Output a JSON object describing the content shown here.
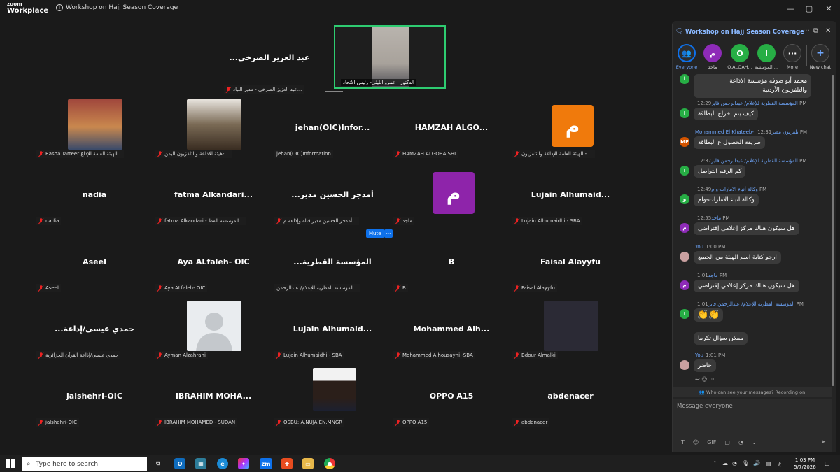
{
  "window": {
    "brand_top": "zoom",
    "brand_bottom": "Workplace",
    "meeting_title": "Workshop on Hajj Season Coverage",
    "controls": [
      "—",
      "▢",
      "✕"
    ]
  },
  "speaker": {
    "name": "عبد العزيز الصرخي...",
    "name_label": "عبد العزيز الصرخي - مدير النباد...",
    "video_label": "الدكتور : عمرو الليثي- رئيس الاتحاد"
  },
  "tiles": [
    {
      "name": "",
      "label": "Rasha Tarteer الهيئة العامة للإذاع..."
    },
    {
      "name": "",
      "label": "هيئة الاذاعة والتلفزيون اليمن- ..."
    },
    {
      "name": "jehan(OIC)Infor...",
      "label": "jehan(OIC)Information"
    },
    {
      "name": "HAMZAH  ALGO...",
      "label": "HAMZAH ALGOBAISHI"
    },
    {
      "name": "",
      "label": "الهيئة العامة للإذاعة والتلفزيون - ...",
      "avatar": "م"
    },
    {
      "name": "nadia",
      "label": "nadia"
    },
    {
      "name": "fatma  Alkandari...",
      "label": "fatma Alkandari - المؤسسة القط..."
    },
    {
      "name": "أمدجر الحسين مدير...",
      "label": "أمدجر الحسين مدير قناة وإذاعة م..."
    },
    {
      "name": "",
      "label": "ماجد",
      "avatar": "م"
    },
    {
      "name": "Lujain  Alhumaid...",
      "label": "Lujain Alhumaidhi - SBA"
    },
    {
      "name": "Aseel",
      "label": "Aseel"
    },
    {
      "name": "Aya ALfaleh- OIC",
      "label": "Aya ALfaleh- OIC"
    },
    {
      "name": "المؤسسة القطرية...",
      "label": "المؤسسة القطرية للإعلام/ عبدالرحمن..."
    },
    {
      "name": "B",
      "label": "B"
    },
    {
      "name": "Faisal Alayyfu",
      "label": "Faisal Alayyfu"
    },
    {
      "name": "حمدي عيسى/إذاعة...",
      "label": "حمدي عيسى/إذاعة القرآن الجزائرية"
    },
    {
      "name": "",
      "label": "Ayman Alzahrani"
    },
    {
      "name": "Lujain  Alhumaid...",
      "label": "Lujain Alhumaidhi - SBA"
    },
    {
      "name": "Mohammed  Alh...",
      "label": "Mohammed Alhousayni -SBA"
    },
    {
      "name": "",
      "label": "Bdour Almalki"
    },
    {
      "name": "jalshehri-OIC",
      "label": "jalshehri-OIC"
    },
    {
      "name": "IBRAHIM  MOHA...",
      "label": "IBRAHIM MOHAMED - SUDAN"
    },
    {
      "name": "",
      "label": "OSBU: A.NUJA EN.MNGR"
    },
    {
      "name": "OPPO A15",
      "label": "OPPO A15"
    },
    {
      "name": "abdenacer",
      "label": "abdenacer"
    }
  ],
  "hover_controls": {
    "mute": "Mute",
    "more": "···"
  },
  "chat": {
    "title": "Workshop on Hajj Season Coverage",
    "recipients": [
      {
        "label": "Everyone",
        "initial": "👥",
        "color": "#2d2d2d"
      },
      {
        "label": "ماجد",
        "initial": "م",
        "color": "#8e2bb8"
      },
      {
        "label": "O.ALQAH...",
        "initial": "O",
        "color": "#27ae45"
      },
      {
        "label": "المؤسسة ...",
        "initial": "ا",
        "color": "#27ae45"
      },
      {
        "label": "More",
        "initial": "···",
        "color": "#2d2d2d"
      },
      {
        "label": "New chat",
        "initial": "+",
        "color": "#2d2d2d"
      }
    ],
    "messages": [
      {
        "sender": "",
        "time": "",
        "text": "محمد أبو صوفه  مؤسسة الاذاعة",
        "text2": "والتلفزيون الأردنية",
        "av": "ا",
        "avcolor": "#27ae45"
      },
      {
        "sender": "المؤسسة القطرية للإعلام/ عبدالرحمن فايز",
        "time": "12:29 PM",
        "text": "كيف يتم اخراج البطاقة",
        "av": "I",
        "avcolor": "#27ae45"
      },
      {
        "sender": "Mohammed El Khateeb- تلفزيون مصر",
        "time": "12:31 PM",
        "text": "طريقة الحصول ع البطاقة",
        "av": "ME",
        "avcolor": "#d35400"
      },
      {
        "sender": "المؤسسة القطرية للإعلام/ عبدالرحمن فايز",
        "time": "12:37 PM",
        "text": "كم الرقم التواصل",
        "av": "I",
        "avcolor": "#27ae45"
      },
      {
        "sender": "وكالة أنباء الامارات-وام",
        "time": "12:49 PM",
        "text": "وكالة انباء الامارات-وام",
        "av": "و",
        "avcolor": "#27ae45"
      },
      {
        "sender": "ماجد",
        "time": "12:55 PM",
        "text": "هل سيكون هناك مركز إعلامي إفتراضي",
        "av": "م",
        "avcolor": "#8e2bb8"
      },
      {
        "sender": "You",
        "time": "1:00 PM",
        "text": "ارجو كتابة اسم الهيئة من الجميع",
        "av": "",
        "avcolor": "#c9a0a0"
      },
      {
        "sender": "ماجد",
        "time": "1:01 PM",
        "text": "هل سيكون هناك مركز إعلامي إفتراضي",
        "av": "م",
        "avcolor": "#8e2bb8"
      },
      {
        "sender": "المؤسسة القطرية للإعلام/ عبدالرحمن فايز",
        "time": "1:01 PM",
        "text": "👏👏",
        "text2": "ممكن سؤال تكرما",
        "av": "I",
        "avcolor": "#27ae45"
      },
      {
        "sender": "You",
        "time": "1:01 PM",
        "text": "حاضر",
        "av": "",
        "avcolor": "#c9a0a0"
      }
    ],
    "who_can_see": "Who can see your messages? Recording on",
    "compose_placeholder": "Message everyone",
    "tools": [
      "T",
      "☺",
      "GIF",
      "▢",
      "◔",
      "◡",
      "⌄"
    ]
  },
  "taskbar": {
    "search_placeholder": "Type here to search",
    "lang": "ع",
    "time": "1:03 PM",
    "date": "5/7/2026"
  }
}
